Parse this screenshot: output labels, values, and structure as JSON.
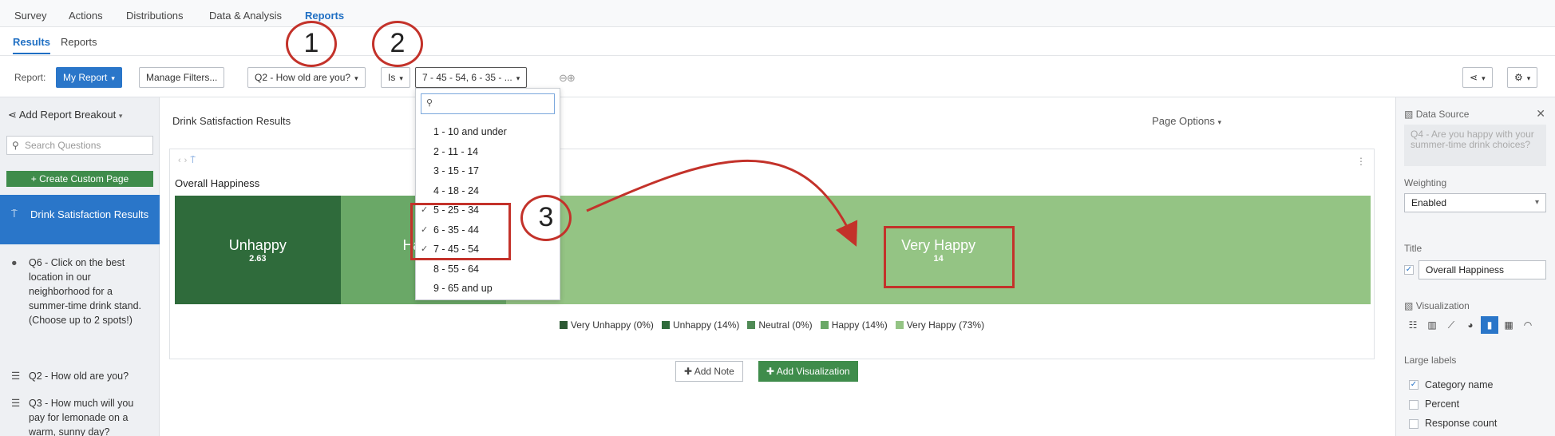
{
  "topnav": {
    "items": [
      "Survey",
      "Actions",
      "Distributions",
      "Data & Analysis",
      "Reports"
    ],
    "active": "Reports"
  },
  "subnav": {
    "items": [
      "Results",
      "Reports"
    ]
  },
  "toolbar": {
    "report_label": "Report:",
    "report_name": "My Report",
    "manage_filters": "Manage Filters...",
    "question_filter": "Q2 - How old are you?",
    "operator": "Is",
    "values": "7 - 45 - 54, 6 - 35 - ..."
  },
  "annotations": [
    "1",
    "2",
    "3"
  ],
  "sidebar": {
    "header": "Add Report Breakout",
    "search_placeholder": "Search Questions",
    "create_page": "+ Create Custom Page",
    "active_page": "Drink Satisfaction Results",
    "questions": [
      "Q6 - Click on the best location in our neighborhood for a summer-time drink stand. (Choose up to 2 spots!)",
      "Q2 - How old are you?",
      "Q3 - How much will you pay for lemonade on a warm, sunny day?"
    ]
  },
  "main": {
    "page_title": "Drink Satisfaction Results",
    "page_options": "Page Options",
    "chart_title": "Overall Happiness",
    "add_note": "Add Note",
    "add_visualization": "Add Visualization"
  },
  "chart_data": {
    "type": "bar",
    "title": "Overall Happiness",
    "orientation": "horizontal-stacked",
    "series": [
      {
        "name": "Very Unhappy (0%)",
        "percent": 0,
        "color": "#2d5a34"
      },
      {
        "name": "Unhappy (14%)",
        "percent": 14,
        "label": "Unhappy",
        "value": "2.63",
        "color": "#2f6b3b"
      },
      {
        "name": "Neutral (0%)",
        "percent": 0,
        "color": "#4f8a55"
      },
      {
        "name": "Happy (14%)",
        "percent": 14,
        "label": "Happy",
        "color": "#6aa867"
      },
      {
        "name": "Very Happy (73%)",
        "percent": 73,
        "label": "Very Happy",
        "value": "14",
        "color": "#94c484"
      }
    ]
  },
  "dropdown": {
    "options": [
      {
        "label": "1 - 10 and under",
        "checked": false
      },
      {
        "label": "2 - 11 - 14",
        "checked": false
      },
      {
        "label": "3 - 15 - 17",
        "checked": false
      },
      {
        "label": "4 - 18 - 24",
        "checked": false
      },
      {
        "label": "5 - 25 - 34",
        "checked": true
      },
      {
        "label": "6 - 35 - 44",
        "checked": true
      },
      {
        "label": "7 - 45 - 54",
        "checked": true
      },
      {
        "label": "8 - 55 - 64",
        "checked": false
      },
      {
        "label": "9 - 65 and up",
        "checked": false
      }
    ]
  },
  "right_panel": {
    "data_source_label": "Data Source",
    "data_source_value": "Q4 - Are you happy with your summer-time drink choices?",
    "weighting_label": "Weighting",
    "weighting_value": "Enabled",
    "title_label": "Title",
    "title_value": "Overall Happiness",
    "visualization_label": "Visualization",
    "large_labels_label": "Large labels",
    "large_labels": [
      {
        "label": "Category name",
        "checked": true
      },
      {
        "label": "Percent",
        "checked": false
      },
      {
        "label": "Response count",
        "checked": false
      }
    ]
  },
  "colors": {
    "accent": "#2a76c9",
    "green": "#3f8c4b",
    "annotation": "#c3322a"
  }
}
